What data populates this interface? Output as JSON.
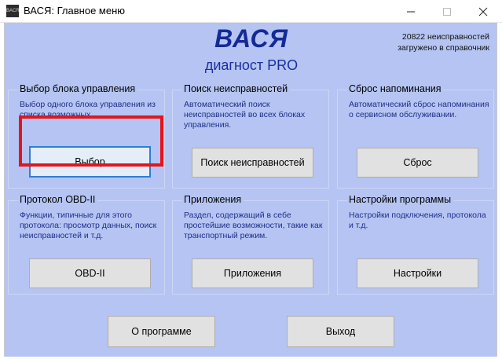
{
  "window": {
    "icon_text": "BACR",
    "title": "ВАСЯ:  Главное меню"
  },
  "brand": {
    "name": "ВАСЯ",
    "subtitle": "диагност PRO"
  },
  "stats": {
    "line1": "20822 неисправностей",
    "line2": "загружено в справочник"
  },
  "groups": [
    {
      "title": "Выбор блока управления",
      "description": "Выбор одного блока управления из списка возможных.",
      "button": "Выбор"
    },
    {
      "title": "Поиск неисправностей",
      "description": "Автоматический поиск неисправностей во всех блоках управления.",
      "button": "Поиск неисправностей"
    },
    {
      "title": "Сброс напоминания",
      "description": "Автоматический сброс напоминания о сервисном обслуживании.",
      "button": "Сброс"
    },
    {
      "title": "Протокол OBD-II",
      "description": "Функции, типичные для этого протокола: просмотр данных, поиск неисправностей и т.д.",
      "button": "OBD-II"
    },
    {
      "title": "Приложения",
      "description": "Раздел, содержащий в себе простейшие возможности, такие как транспортный режим.",
      "button": "Приложения"
    },
    {
      "title": "Настройки программы",
      "description": "Настройки подключения, протокола и т.д.",
      "button": "Настройки"
    }
  ],
  "footer": {
    "about_label": "О программе",
    "exit_label": "Выход"
  },
  "colors": {
    "client_bg": "#b5c4f2",
    "brand": "#142a96",
    "description": "#1f2f8a",
    "highlight": "#e4141d",
    "focus": "#2e7fd4"
  }
}
